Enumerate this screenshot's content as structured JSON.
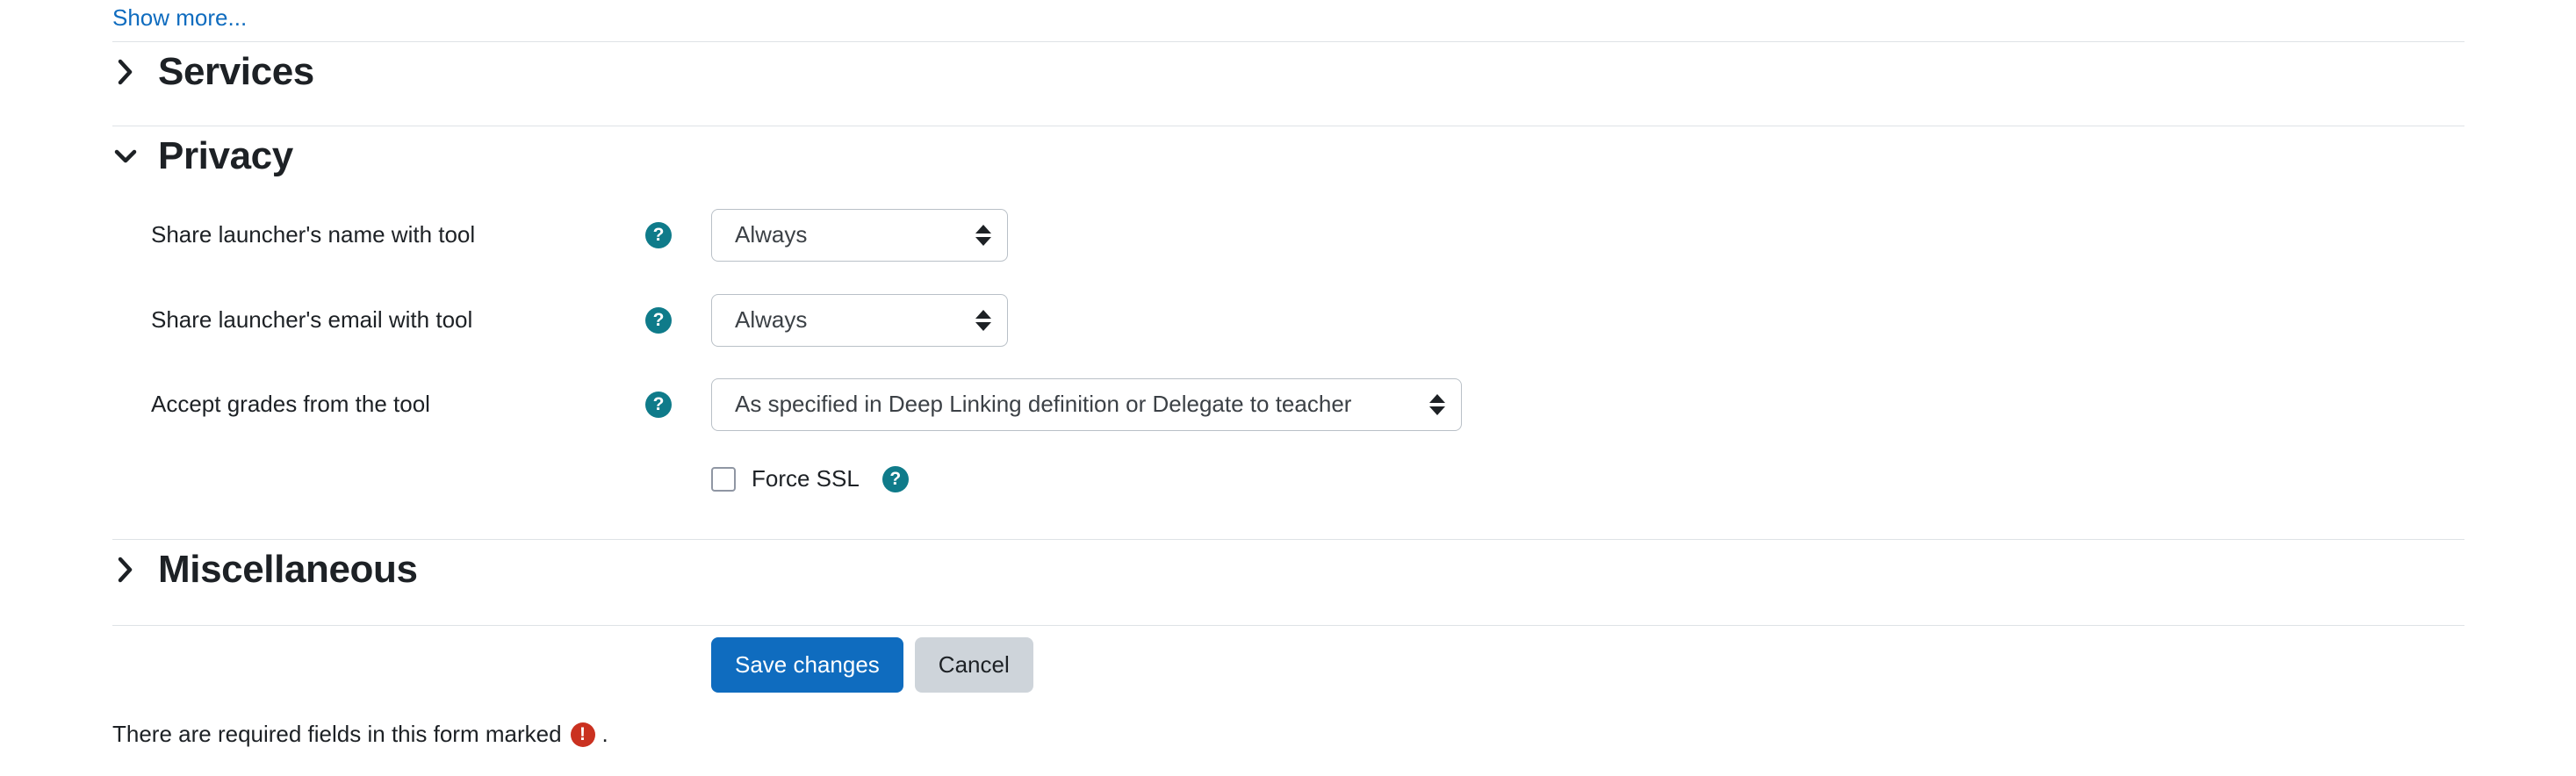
{
  "show_more": {
    "label": "Show more..."
  },
  "sections": {
    "services": {
      "title": "Services",
      "chevron": "chevron-right-icon",
      "expanded": false
    },
    "privacy": {
      "title": "Privacy",
      "chevron": "chevron-down-icon",
      "expanded": true
    },
    "miscellaneous": {
      "title": "Miscellaneous",
      "chevron": "chevron-right-icon",
      "expanded": false
    }
  },
  "privacy_fields": [
    {
      "label": "Share launcher's name with tool",
      "help_icon": "help-circle-icon",
      "value": "Always",
      "control": "select"
    },
    {
      "label": "Share launcher's email with tool",
      "help_icon": "help-circle-icon",
      "value": "Always",
      "control": "select"
    },
    {
      "label": "Accept grades from the tool",
      "help_icon": "help-circle-icon",
      "value": "As specified in Deep Linking definition or Delegate to teacher",
      "control": "select"
    }
  ],
  "force_ssl": {
    "label": "Force SSL",
    "checked": false,
    "help_icon": "help-circle-icon"
  },
  "actions": {
    "save_label": "Save changes",
    "cancel_label": "Cancel"
  },
  "required_note": {
    "text_before": "There are required fields in this form marked",
    "icon": "required-exclamation-icon",
    "text_after": "."
  },
  "colors": {
    "link": "#0f6cbf",
    "primary_button": "#0f6cbf",
    "secondary_button": "#ced4da",
    "help_icon": "#0f7b8a",
    "required_icon": "#ca3120",
    "divider": "#dee2e6",
    "text": "#1d2125"
  }
}
